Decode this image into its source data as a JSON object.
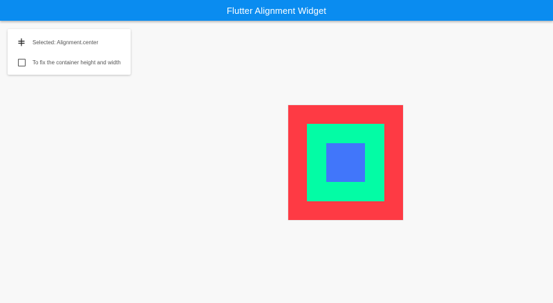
{
  "appbar": {
    "title": "Flutter Alignment Widget",
    "color": "#0a8cf0"
  },
  "options": {
    "alignment": {
      "icon": "align-center-icon",
      "label": "Selected: Alignment.center"
    },
    "fix_size": {
      "icon": "checkbox-unchecked-icon",
      "label": "To fix the container height and width",
      "checked": false
    }
  },
  "containers": {
    "outer_color": "#fe3a44",
    "middle_color": "#03fca5",
    "inner_color": "#4176fa"
  }
}
